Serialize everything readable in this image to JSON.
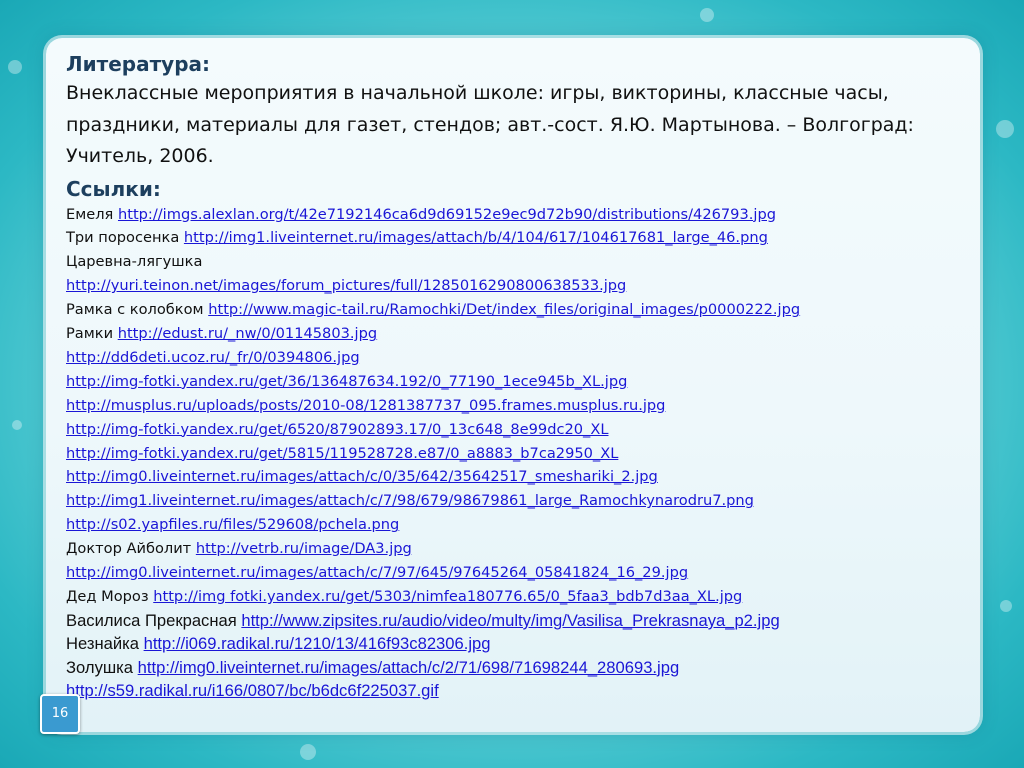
{
  "literature_heading": "Литература:",
  "book_reference": "Внеклассные мероприятия в начальной школе: игры, викторины, классные часы, праздники, материалы для газет, стендов; авт.-сост. Я.Ю. Мартынова. – Волгоград: Учитель, 2006.",
  "links_heading": "Ссылки:",
  "links": [
    {
      "label": "Емеля ",
      "url": "http://imgs.alexlan.org/t/42e7192146ca6d9d69152e9ec9d72b90/distributions/426793.jpg"
    },
    {
      "label": "Три поросенка ",
      "url": "http://img1.liveinternet.ru/images/attach/b/4/104/617/104617681_large_46.png"
    },
    {
      "label": "Царевна-лягушка",
      "url": ""
    },
    {
      "label": "",
      "url": "http://yuri.teinon.net/images/forum_pictures/full/1285016290800638533.jpg"
    },
    {
      "label": "Рамка с колобком ",
      "url": "http://www.magic-tail.ru/Ramochki/Det/index_files/original_images/p0000222.jpg"
    },
    {
      "label": "Рамки ",
      "url": "http://edust.ru/_nw/0/01145803.jpg"
    },
    {
      "label": "",
      "url": "http://dd6deti.ucoz.ru/_fr/0/0394806.jpg"
    },
    {
      "label": "",
      "url": "http://img-fotki.yandex.ru/get/36/136487634.192/0_77190_1ece945b_XL.jpg"
    },
    {
      "label": "",
      "url": "http://musplus.ru/uploads/posts/2010-08/1281387737_095.frames.musplus.ru.jpg"
    },
    {
      "label": "",
      "url": "http://img-fotki.yandex.ru/get/6520/87902893.17/0_13c648_8e99dc20_XL"
    },
    {
      "label": "",
      "url": "http://img-fotki.yandex.ru/get/5815/119528728.e87/0_a8883_b7ca2950_XL"
    },
    {
      "label": "",
      "url": "http://img0.liveinternet.ru/images/attach/c/0/35/642/35642517_smeshariki_2.jpg"
    },
    {
      "label": "",
      "url": "http://img1.liveinternet.ru/images/attach/c/7/98/679/98679861_large_Ramochkynarodru7.png"
    },
    {
      "label": "",
      "url": "http://s02.yapfiles.ru/files/529608/pchela.png"
    },
    {
      "label": "Доктор Айболит  ",
      "url": "http://vetrb.ru/image/DA3.jpg"
    },
    {
      "label": "",
      "url": "http://img0.liveinternet.ru/images/attach/c/7/97/645/97645264_05841824_16_29.jpg"
    },
    {
      "label": "Дед Мороз ",
      "url": "http://img fotki.yandex.ru/get/5303/nimfea180776.65/0_5faa3_bdb7d3aa_XL.jpg"
    },
    {
      "label": "Василиса Прекрасная ",
      "url": "http://www.zipsites.ru/audio/video/multy/img/Vasilisa_Prekrasnaya_p2.jpg"
    },
    {
      "label": "Незнайка ",
      "url": "http://i069.radikal.ru/1210/13/416f93c82306.jpg"
    },
    {
      "label": "Золушка ",
      "url": "http://img0.liveinternet.ru/images/attach/c/2/71/698/71698244_280693.jpg"
    },
    {
      "label": "",
      "url": "http://s59.radikal.ru/i166/0807/bc/b6dc6f225037.gif"
    }
  ],
  "slide_number": "16"
}
